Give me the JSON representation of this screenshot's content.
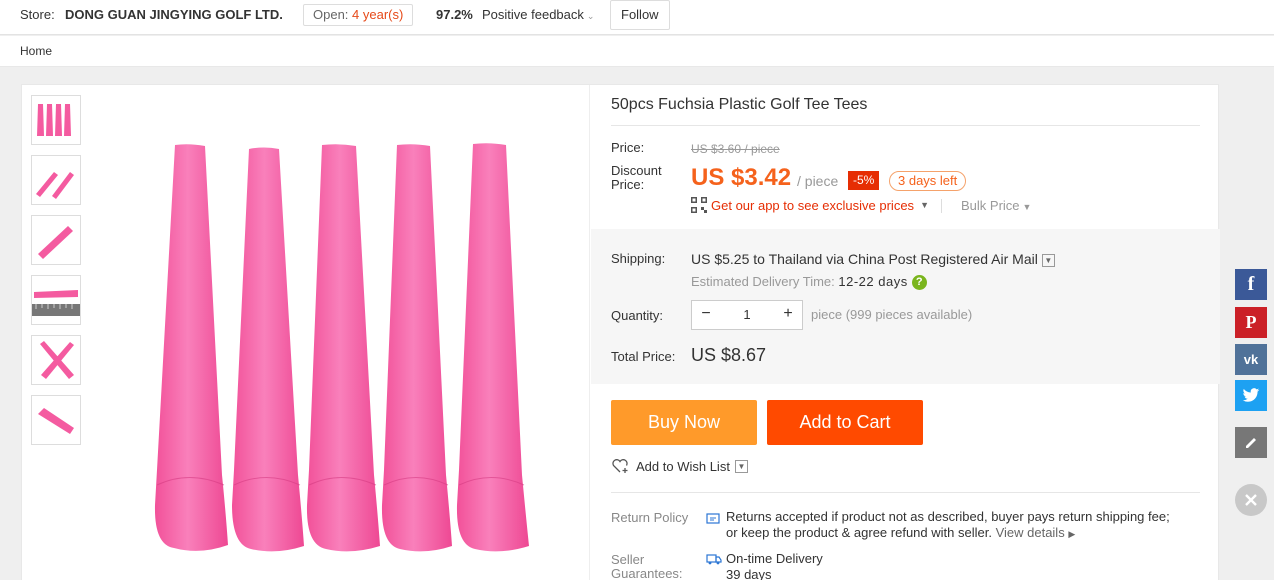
{
  "store": {
    "label": "Store:",
    "name": "DONG GUAN JINGYING GOLF LTD.",
    "open_label": "Open:",
    "open_value": "4 year(s)",
    "feedback_pct": "97.2%",
    "feedback_label": "Positive feedback",
    "follow_label": "Follow"
  },
  "breadcrumb": {
    "home": "Home"
  },
  "product": {
    "title": "50pcs Fuchsia Plastic Golf Tee Tees",
    "price_label": "Price:",
    "original_price": "US $3.60 / piece",
    "discount_label_1": "Discount",
    "discount_label_2": "Price:",
    "discount_price": "US $3.42",
    "per_piece": "/ piece",
    "discount_pct": "-5%",
    "days_left": "3 days left",
    "app_prices": "Get our app to see exclusive prices",
    "bulk_price": "Bulk Price"
  },
  "shipping": {
    "label": "Shipping:",
    "price": "US $5.25",
    "to_text": "to",
    "destination": "Thailand",
    "via_text": "via China Post Registered Air Mail",
    "est_label": "Estimated Delivery Time:",
    "est_days": "12-22 days"
  },
  "quantity": {
    "label": "Quantity:",
    "value": "1",
    "minus": "−",
    "plus": "+",
    "available": "piece (999 pieces available)"
  },
  "total": {
    "label": "Total Price:",
    "value": "US $8.67"
  },
  "actions": {
    "buy_now": "Buy Now",
    "add_to_cart": "Add to Cart",
    "wish_list": "Add to Wish List"
  },
  "policy": {
    "return_label": "Return Policy",
    "return_text_1": "Returns accepted if product not as described, buyer pays return shipping fee;",
    "return_text_2": "or keep the product & agree refund with seller.",
    "view_details": "View details",
    "guarantee_label_1": "Seller",
    "guarantee_label_2": "Guarantees:",
    "guarantee_title": "On-time Delivery",
    "guarantee_days": "39 days"
  },
  "social": {
    "facebook": "f",
    "pinterest": "P",
    "vk": "vk",
    "twitter_icon": "twitter-icon",
    "edit_icon": "pencil-icon",
    "close_icon": "close-icon"
  },
  "colors": {
    "accent": "#f5621c",
    "buy": "#ff9a2a",
    "cart": "#ff4a00",
    "product_pink": "#f45ba0"
  }
}
